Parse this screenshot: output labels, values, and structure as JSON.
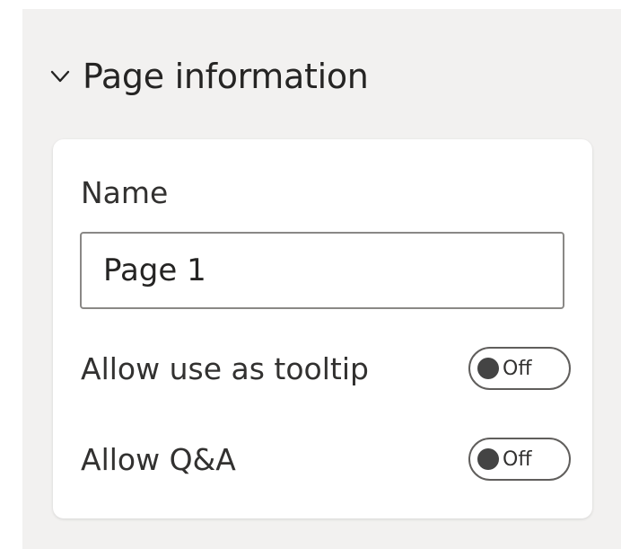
{
  "page_information": {
    "title": "Page information",
    "expanded": true,
    "chevron_icon": "chevron-down-icon",
    "name_label": "Name",
    "name_value": "Page 1",
    "toggles": [
      {
        "label": "Allow use as tooltip",
        "state": "Off"
      },
      {
        "label": "Allow Q&A",
        "state": "Off"
      }
    ]
  },
  "colors": {
    "panel_bg": "#f2f1f0",
    "card_bg": "#ffffff",
    "text": "#252423",
    "border": "#8a8886"
  }
}
